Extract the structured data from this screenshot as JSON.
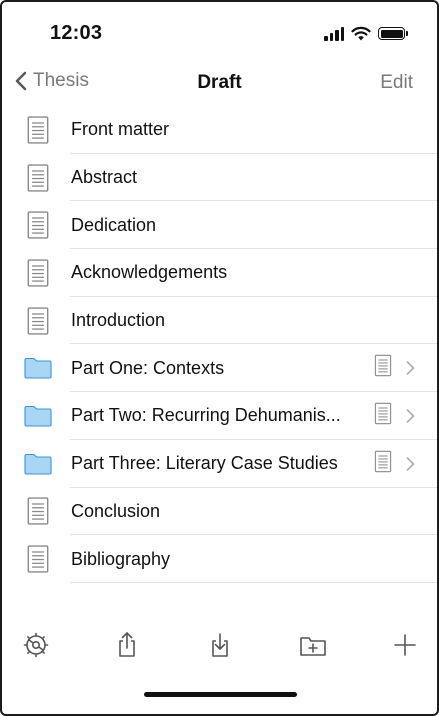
{
  "status_bar": {
    "time": "12:03"
  },
  "nav": {
    "back_label": "Thesis",
    "title": "Draft",
    "edit_label": "Edit"
  },
  "items": [
    {
      "label": "Front matter",
      "type": "document",
      "has_text": false
    },
    {
      "label": "Abstract",
      "type": "document",
      "has_text": false
    },
    {
      "label": "Dedication",
      "type": "document",
      "has_text": false
    },
    {
      "label": "Acknowledgements",
      "type": "document",
      "has_text": false
    },
    {
      "label": "Introduction",
      "type": "document",
      "has_text": false
    },
    {
      "label": "Part One: Contexts",
      "type": "folder",
      "has_text": true
    },
    {
      "label": "Part Two: Recurring Dehumanis...",
      "type": "folder",
      "has_text": true
    },
    {
      "label": "Part Three: Literary Case Studies",
      "type": "folder",
      "has_text": true
    },
    {
      "label": "Conclusion",
      "type": "document",
      "has_text": false
    },
    {
      "label": "Bibliography",
      "type": "document",
      "has_text": false
    }
  ],
  "toolbar": [
    "settings-icon",
    "share-icon",
    "import-icon",
    "add-folder-icon",
    "add-icon"
  ],
  "colors": {
    "folder_fill": "#aad6f5",
    "folder_stroke": "#3c93d0",
    "doc_stroke": "#8a8a8a",
    "separator": "#e3e3e6",
    "nav_gray": "#7a7a7a"
  }
}
